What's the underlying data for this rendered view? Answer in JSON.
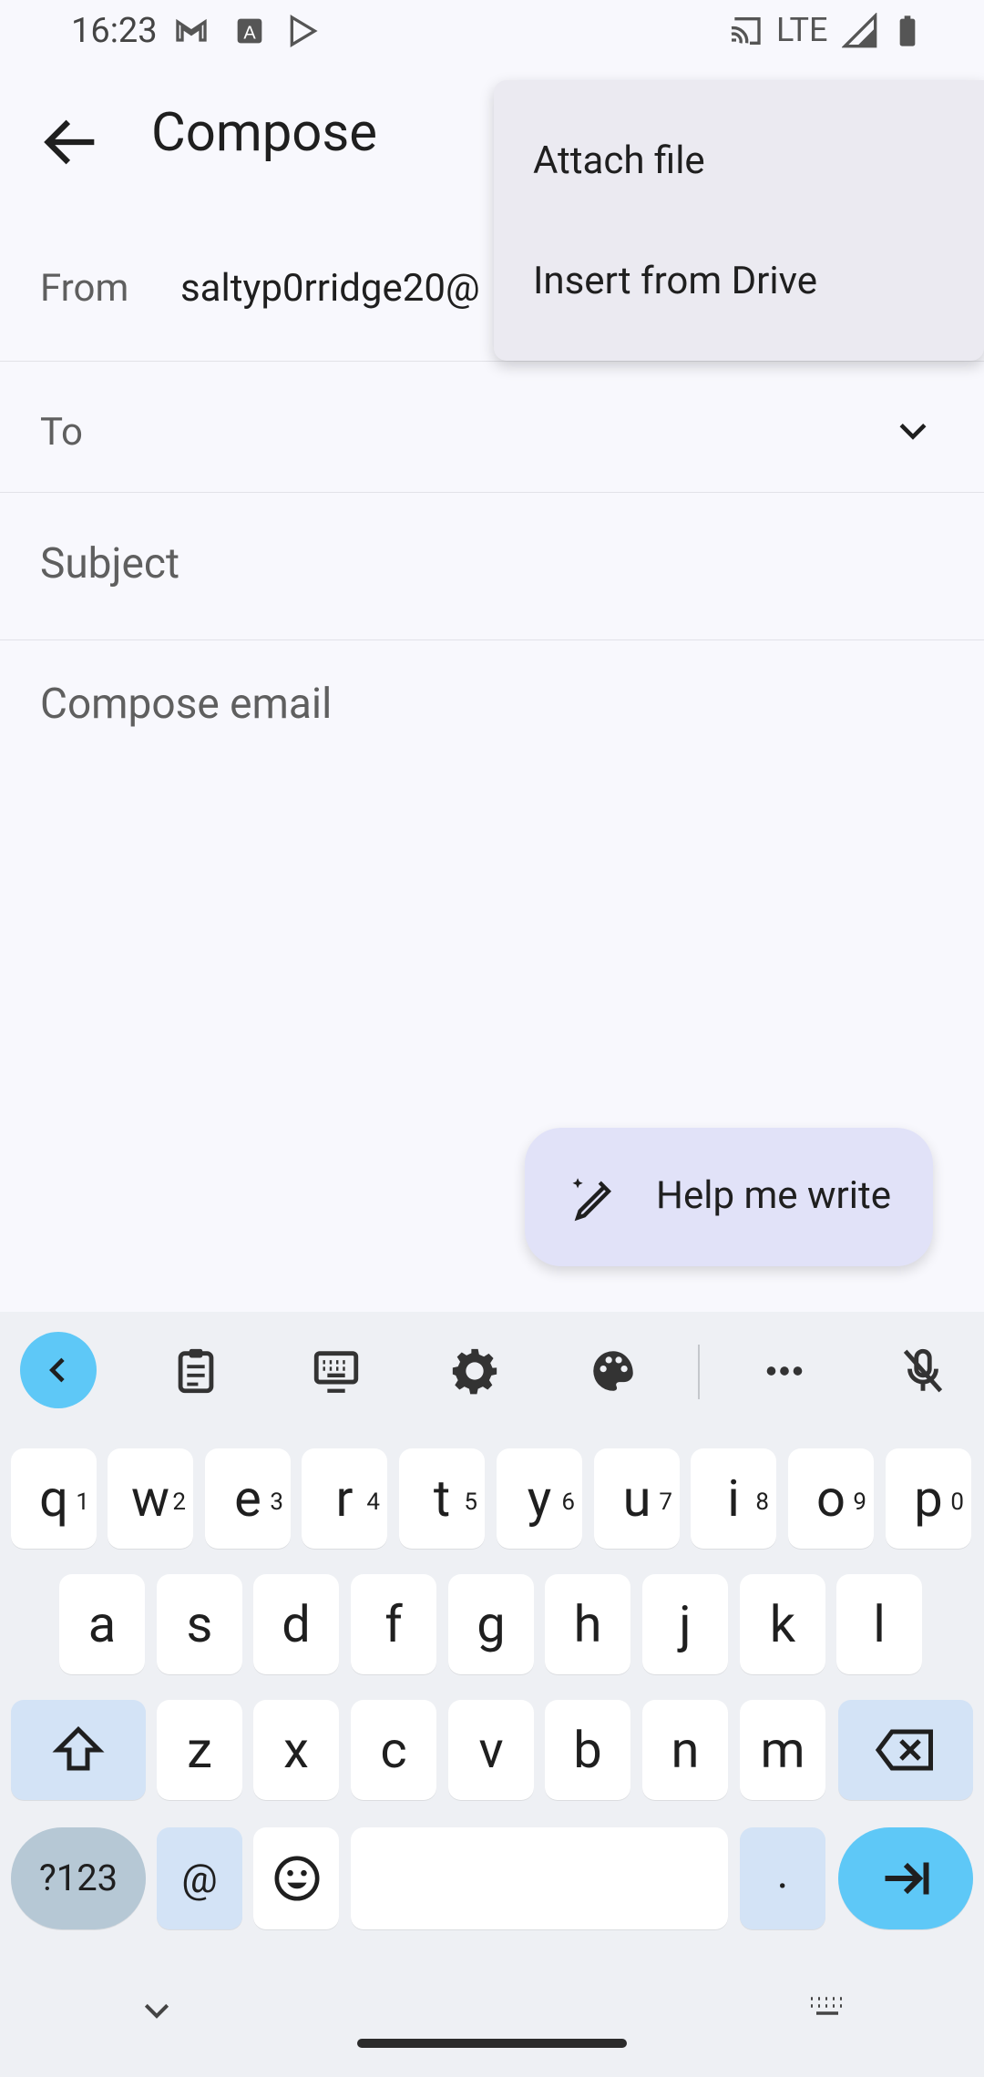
{
  "status_bar": {
    "time": "16:23",
    "network": "LTE"
  },
  "app_bar": {
    "title": "Compose",
    "back_icon": "arrow-back-icon"
  },
  "compose": {
    "from_label": "From",
    "from_value": "saltyp0rridge20@",
    "to_label": "To",
    "subject_placeholder": "Subject",
    "body_placeholder": "Compose email"
  },
  "attach_menu": {
    "items": [
      "Attach file",
      "Insert from Drive"
    ]
  },
  "help_me_write": {
    "label": "Help me write"
  },
  "keyboard": {
    "toolbar_icons": [
      "chevron-left-icon",
      "clipboard-icon",
      "keyboard-icon",
      "gear-icon",
      "palette-icon",
      "more-icon",
      "mic-off-icon"
    ],
    "row1": [
      {
        "key": "q",
        "hint": "1"
      },
      {
        "key": "w",
        "hint": "2"
      },
      {
        "key": "e",
        "hint": "3"
      },
      {
        "key": "r",
        "hint": "4"
      },
      {
        "key": "t",
        "hint": "5"
      },
      {
        "key": "y",
        "hint": "6"
      },
      {
        "key": "u",
        "hint": "7"
      },
      {
        "key": "i",
        "hint": "8"
      },
      {
        "key": "o",
        "hint": "9"
      },
      {
        "key": "p",
        "hint": "0"
      }
    ],
    "row2": [
      "a",
      "s",
      "d",
      "f",
      "g",
      "h",
      "j",
      "k",
      "l"
    ],
    "row3": [
      "z",
      "x",
      "c",
      "v",
      "b",
      "n",
      "m"
    ],
    "symbols_key": "?123",
    "at_key": "@",
    "period_key": "."
  },
  "colors": {
    "accent": "#5ec8f7",
    "menu_bg": "#ebeaf1",
    "help_bg": "#e1e2f8"
  }
}
